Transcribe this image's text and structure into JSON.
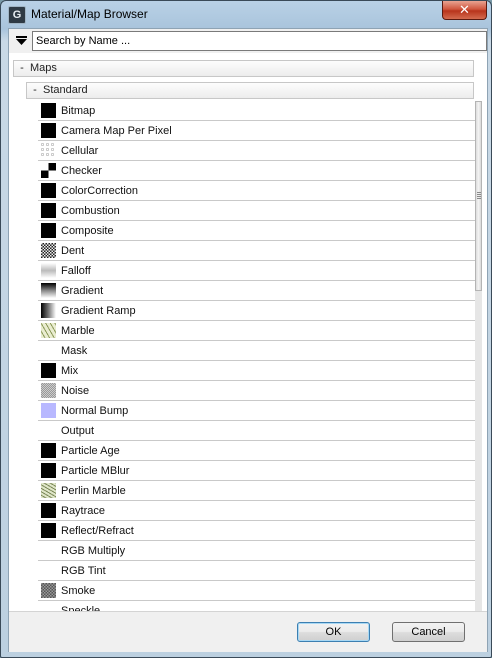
{
  "window": {
    "title": "Material/Map Browser",
    "app_icon_glyph": "G",
    "close_glyph": "✕"
  },
  "search": {
    "value": "",
    "placeholder": "Search by Name ..."
  },
  "tree": {
    "maps_group": {
      "toggle": "-",
      "label": "Maps"
    },
    "standard_group": {
      "toggle": "-",
      "label": "Standard"
    }
  },
  "items": [
    {
      "label": "Bitmap",
      "icon": "bitmap-swatch-icon"
    },
    {
      "label": "Camera Map Per Pixel",
      "icon": "camera-map-swatch-icon"
    },
    {
      "label": "Cellular",
      "icon": "cellular-swatch-icon"
    },
    {
      "label": "Checker",
      "icon": "checker-swatch-icon"
    },
    {
      "label": "ColorCorrection",
      "icon": "colorcorrection-swatch-icon"
    },
    {
      "label": "Combustion",
      "icon": "combustion-swatch-icon"
    },
    {
      "label": "Composite",
      "icon": "composite-swatch-icon"
    },
    {
      "label": "Dent",
      "icon": "dent-swatch-icon"
    },
    {
      "label": "Falloff",
      "icon": "falloff-swatch-icon"
    },
    {
      "label": "Gradient",
      "icon": "gradient-swatch-icon"
    },
    {
      "label": "Gradient Ramp",
      "icon": "gradient-ramp-swatch-icon"
    },
    {
      "label": "Marble",
      "icon": "marble-swatch-icon"
    },
    {
      "label": "Mask",
      "icon": "mask-swatch-icon"
    },
    {
      "label": "Mix",
      "icon": "mix-swatch-icon"
    },
    {
      "label": "Noise",
      "icon": "noise-swatch-icon"
    },
    {
      "label": "Normal Bump",
      "icon": "normal-bump-swatch-icon"
    },
    {
      "label": "Output",
      "icon": "output-swatch-icon"
    },
    {
      "label": "Particle Age",
      "icon": "particle-age-swatch-icon"
    },
    {
      "label": "Particle MBlur",
      "icon": "particle-mblur-swatch-icon"
    },
    {
      "label": "Perlin Marble",
      "icon": "perlin-marble-swatch-icon"
    },
    {
      "label": "Raytrace",
      "icon": "raytrace-swatch-icon"
    },
    {
      "label": "Reflect/Refract",
      "icon": "reflect-refract-swatch-icon"
    },
    {
      "label": "RGB Multiply",
      "icon": "rgb-multiply-swatch-icon"
    },
    {
      "label": "RGB Tint",
      "icon": "rgb-tint-swatch-icon"
    },
    {
      "label": "Smoke",
      "icon": "smoke-swatch-icon"
    },
    {
      "label": "Speckle",
      "icon": "speckle-swatch-icon"
    }
  ],
  "buttons": {
    "ok": "OK",
    "cancel": "Cancel"
  },
  "colors": {
    "normal_bump": "#b8b8ff",
    "black": "#000000",
    "white": "#ffffff"
  }
}
